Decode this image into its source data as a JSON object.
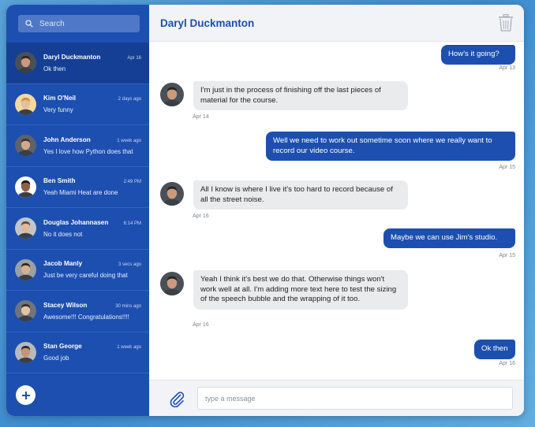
{
  "sidebar": {
    "search_placeholder": "Search",
    "contacts": [
      {
        "name": "Daryl Duckmanton",
        "time": "Apr 16",
        "message": "Ok then",
        "active": true
      },
      {
        "name": "Kim O'Neil",
        "time": "2 days ago",
        "message": "Very funny"
      },
      {
        "name": "John Anderson",
        "time": "1 week ago",
        "message": "Yes I love how Python does that"
      },
      {
        "name": "Ben Smith",
        "time": "2:49 PM",
        "message": "Yeah Miami Heat are done"
      },
      {
        "name": "Douglas Johannasen",
        "time": "6:14 PM",
        "message": "No it does not"
      },
      {
        "name": "Jacob Manly",
        "time": "3 secs ago",
        "message": "Just be very careful doing that"
      },
      {
        "name": "Stacey Wilson",
        "time": "30 mins ago",
        "message": "Awesome!!! Congratulations!!!!"
      },
      {
        "name": "Stan George",
        "time": "1 week ago",
        "message": "Good job"
      }
    ]
  },
  "header": {
    "title": "Daryl Duckmanton"
  },
  "messages": [
    {
      "direction": "out",
      "text": "How's it going?",
      "time": "Apr 13"
    },
    {
      "direction": "in",
      "text": "I'm just in the process of finishing off the last pieces of material for the course.",
      "time": "Apr 14"
    },
    {
      "direction": "out",
      "text": "Well we need to work out sometime soon where we really want to record our video course.",
      "time": "Apr 15"
    },
    {
      "direction": "in",
      "text": "All I know is where I live it's too hard to record because of all the street noise.",
      "time": "Apr 16"
    },
    {
      "direction": "out",
      "text": "Maybe we can use Jim's studio.",
      "time": "Apr 15"
    },
    {
      "direction": "in",
      "text": "Yeah I think it's best we do that. Otherwise things won't work well at all. I'm adding more text here to test the sizing of the speech bubble and the wrapping of it too.",
      "time": "Apr 16"
    },
    {
      "direction": "out",
      "text": "Ok then",
      "time": "Apr 16"
    }
  ],
  "composer": {
    "placeholder": "type a message"
  },
  "colors": {
    "accent": "#1d4fb0",
    "sidebar": "#1d4fb0",
    "active_row": "#153f94",
    "incoming_bubble": "#eaebed"
  }
}
